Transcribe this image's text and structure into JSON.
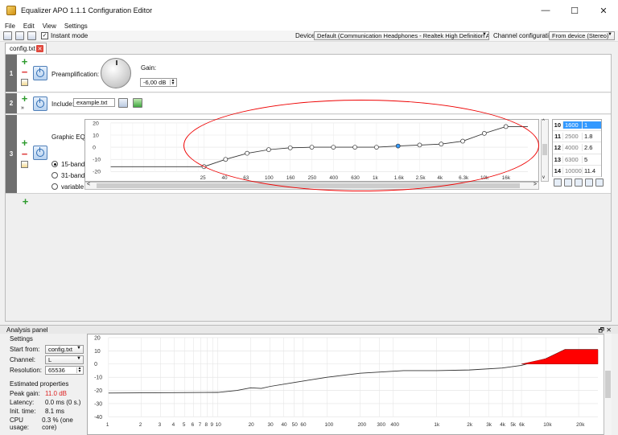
{
  "window": {
    "title": "Equalizer APO 1.1.1 Configuration Editor",
    "minimize": "—",
    "maximize": "☐",
    "close": "✕"
  },
  "menu": [
    "File",
    "Edit",
    "View",
    "Settings"
  ],
  "toolbar": {
    "instant_mode": "Instant mode",
    "device_label": "Device:",
    "device_value": "Default (Communication Headphones - Realtek High Definition Audio)",
    "channel_config_label": "Channel configuration:",
    "channel_config_value": "From device (Stereo)"
  },
  "tabs": [
    {
      "label": "config.txt",
      "close": "✕"
    }
  ],
  "rows": {
    "r1": {
      "num": "1",
      "label": "Preamplification:",
      "gain_label": "Gain:",
      "gain_value": "-6,00 dB"
    },
    "r2": {
      "num": "2",
      "label": "Include:",
      "file": "example.txt",
      "expand": "»"
    },
    "r3": {
      "num": "3",
      "label": "Graphic EQ:",
      "modes": [
        "15-band",
        "31-band",
        "variable"
      ],
      "selected_mode": "15-band",
      "bands": [
        {
          "idx": "10",
          "freq": "1600",
          "gain": "1"
        },
        {
          "idx": "11",
          "freq": "2500",
          "gain": "1.8"
        },
        {
          "idx": "12",
          "freq": "4000",
          "gain": "2.6"
        },
        {
          "idx": "13",
          "freq": "6300",
          "gain": "5"
        },
        {
          "idx": "14",
          "freq": "10000",
          "gain": "11.4"
        }
      ],
      "selected_band": "10"
    }
  },
  "eq_chart": {
    "y_ticks": [
      "20",
      "10",
      "0",
      "-10",
      "-20"
    ],
    "x_ticks": [
      "25",
      "40",
      "63",
      "100",
      "160",
      "250",
      "400",
      "630",
      "1k",
      "1.6k",
      "2.5k",
      "4k",
      "6.3k",
      "10k",
      "16k"
    ],
    "gains": [
      -16,
      -10,
      -5,
      -2,
      -0.5,
      0,
      0,
      0,
      0,
      1,
      1.8,
      2.6,
      5,
      11.4,
      17
    ],
    "selected_index": 9,
    "scroll_left": "<",
    "scroll_right": ">",
    "scroll_up": "^",
    "scroll_down": "v"
  },
  "analysis": {
    "title": "Analysis panel",
    "header_icons": "🗗 ✕",
    "settings_title": "Settings",
    "start_from_label": "Start from:",
    "start_from_value": "config.txt",
    "channel_label": "Channel:",
    "channel_value": "L",
    "resolution_label": "Resolution:",
    "resolution_value": "65536",
    "estimated_title": "Estimated properties",
    "peak_gain_label": "Peak gain:",
    "peak_gain_value": "11.0 dB",
    "latency_label": "Latency:",
    "latency_value": "0.0 ms (0 s.)",
    "init_time_label": "Init. time:",
    "init_time_value": "8.1 ms",
    "cpu_label": "CPU usage:",
    "cpu_value": "0.3 % (one core)"
  },
  "analysis_chart": {
    "y_ticks": [
      "20",
      "10",
      "0",
      "-10",
      "-20",
      "-30",
      "-40"
    ],
    "x_ticks": [
      "1",
      "2",
      "3",
      "4",
      "5",
      "6",
      "7",
      "8",
      "9",
      "10",
      "20",
      "30",
      "40",
      "50",
      "60",
      "100",
      "200",
      "300",
      "400",
      "1k",
      "2k",
      "3k",
      "4k",
      "5k",
      "6k",
      "10k",
      "20k"
    ]
  },
  "colors": {
    "accent": "#3399ff",
    "peak": "#ff0000",
    "annotation": "#e00000"
  }
}
